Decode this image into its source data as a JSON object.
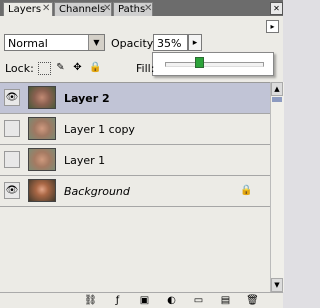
{
  "tabs": [
    {
      "label": "Layers",
      "active": true
    },
    {
      "label": "Channels",
      "active": false
    },
    {
      "label": "Paths",
      "active": false
    }
  ],
  "blend_mode": "Normal",
  "opacity_label": "Opacity:",
  "opacity_value": "35%",
  "opacity_slider_fraction": 0.35,
  "lock_label": "Lock:",
  "fill_label": "Fill:",
  "layers": [
    {
      "name": "Layer 2",
      "visible": true,
      "selected": true,
      "style": "bold"
    },
    {
      "name": "Layer 1 copy",
      "visible": false,
      "selected": false,
      "style": "normal"
    },
    {
      "name": "Layer 1",
      "visible": false,
      "selected": false,
      "style": "normal"
    },
    {
      "name": "Background",
      "visible": true,
      "selected": false,
      "style": "italic",
      "locked": true
    }
  ],
  "colors": {
    "selected_row": "#c1c4d6",
    "slider_thumb": "#2ca33a"
  }
}
